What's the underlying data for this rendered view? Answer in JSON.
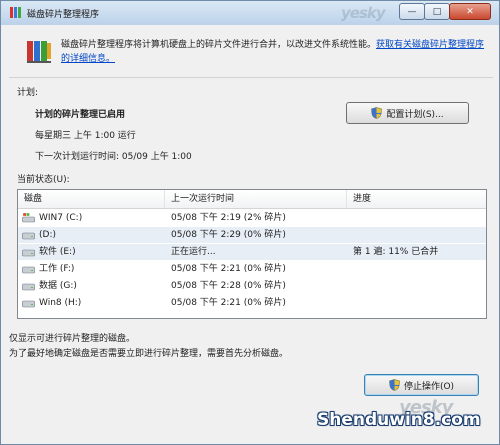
{
  "window": {
    "title": "磁盘碎片整理程序",
    "minimize_glyph": "—",
    "maximize_glyph": "□",
    "close_glyph": "✕",
    "watermark_top": "yesky"
  },
  "intro": {
    "text": "磁盘碎片整理程序将计算机硬盘上的碎片文件进行合并，以改进文件系统性能。",
    "link": "获取有关磁盘碎片整理程序的详细信息。"
  },
  "schedule": {
    "label": "计划:",
    "status": "计划的碎片整理已启用",
    "frequency": "每星期三 上午 1:00 运行",
    "next_run": "下一次计划运行时间: 05/09 上午 1:00",
    "config_button": "配置计划(S)..."
  },
  "current_status": {
    "label": "当前状态(U):",
    "columns": [
      "磁盘",
      "上一次运行时间",
      "进度"
    ],
    "rows": [
      {
        "disk": "WIN7 (C:)",
        "last_run": "05/08 下午 2:19 (2% 碎片)",
        "progress": ""
      },
      {
        "disk": "(D:)",
        "last_run": "05/08 下午 2:29 (0% 碎片)",
        "progress": ""
      },
      {
        "disk": "软件 (E:)",
        "last_run": "正在运行...",
        "progress": "第 1 遍: 11% 已合并"
      },
      {
        "disk": "工作 (F:)",
        "last_run": "05/08 下午 2:21 (0% 碎片)",
        "progress": ""
      },
      {
        "disk": "数据 (G:)",
        "last_run": "05/08 下午 2:28 (0% 碎片)",
        "progress": ""
      },
      {
        "disk": "Win8 (H:)",
        "last_run": "05/08 下午 2:21 (0% 碎片)",
        "progress": ""
      }
    ]
  },
  "notes": {
    "line1": "仅显示可进行碎片整理的磁盘。",
    "line2": "为了最好地确定磁盘是否需要立即进行碎片整理，需要首先分析磁盘。"
  },
  "stop_button": "停止操作(O)",
  "watermark_bottom": "yesky",
  "site_watermark": "Shenduwin8.com",
  "colors": {
    "link": "#0046c5",
    "selected_row": "#e8eef6",
    "title_gradient_top": "#dbe8f5"
  }
}
